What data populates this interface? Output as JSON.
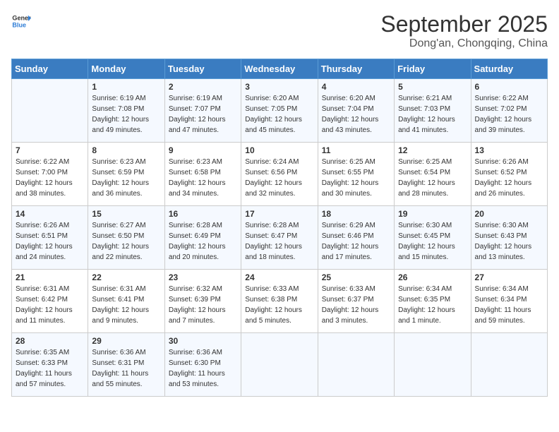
{
  "header": {
    "logo_general": "General",
    "logo_blue": "Blue",
    "month_title": "September 2025",
    "location": "Dong'an, Chongqing, China"
  },
  "days_of_week": [
    "Sunday",
    "Monday",
    "Tuesday",
    "Wednesday",
    "Thursday",
    "Friday",
    "Saturday"
  ],
  "weeks": [
    [
      {
        "day": "",
        "sunrise": "",
        "sunset": "",
        "daylight": ""
      },
      {
        "day": "1",
        "sunrise": "Sunrise: 6:19 AM",
        "sunset": "Sunset: 7:08 PM",
        "daylight": "Daylight: 12 hours and 49 minutes."
      },
      {
        "day": "2",
        "sunrise": "Sunrise: 6:19 AM",
        "sunset": "Sunset: 7:07 PM",
        "daylight": "Daylight: 12 hours and 47 minutes."
      },
      {
        "day": "3",
        "sunrise": "Sunrise: 6:20 AM",
        "sunset": "Sunset: 7:05 PM",
        "daylight": "Daylight: 12 hours and 45 minutes."
      },
      {
        "day": "4",
        "sunrise": "Sunrise: 6:20 AM",
        "sunset": "Sunset: 7:04 PM",
        "daylight": "Daylight: 12 hours and 43 minutes."
      },
      {
        "day": "5",
        "sunrise": "Sunrise: 6:21 AM",
        "sunset": "Sunset: 7:03 PM",
        "daylight": "Daylight: 12 hours and 41 minutes."
      },
      {
        "day": "6",
        "sunrise": "Sunrise: 6:22 AM",
        "sunset": "Sunset: 7:02 PM",
        "daylight": "Daylight: 12 hours and 39 minutes."
      }
    ],
    [
      {
        "day": "7",
        "sunrise": "Sunrise: 6:22 AM",
        "sunset": "Sunset: 7:00 PM",
        "daylight": "Daylight: 12 hours and 38 minutes."
      },
      {
        "day": "8",
        "sunrise": "Sunrise: 6:23 AM",
        "sunset": "Sunset: 6:59 PM",
        "daylight": "Daylight: 12 hours and 36 minutes."
      },
      {
        "day": "9",
        "sunrise": "Sunrise: 6:23 AM",
        "sunset": "Sunset: 6:58 PM",
        "daylight": "Daylight: 12 hours and 34 minutes."
      },
      {
        "day": "10",
        "sunrise": "Sunrise: 6:24 AM",
        "sunset": "Sunset: 6:56 PM",
        "daylight": "Daylight: 12 hours and 32 minutes."
      },
      {
        "day": "11",
        "sunrise": "Sunrise: 6:25 AM",
        "sunset": "Sunset: 6:55 PM",
        "daylight": "Daylight: 12 hours and 30 minutes."
      },
      {
        "day": "12",
        "sunrise": "Sunrise: 6:25 AM",
        "sunset": "Sunset: 6:54 PM",
        "daylight": "Daylight: 12 hours and 28 minutes."
      },
      {
        "day": "13",
        "sunrise": "Sunrise: 6:26 AM",
        "sunset": "Sunset: 6:52 PM",
        "daylight": "Daylight: 12 hours and 26 minutes."
      }
    ],
    [
      {
        "day": "14",
        "sunrise": "Sunrise: 6:26 AM",
        "sunset": "Sunset: 6:51 PM",
        "daylight": "Daylight: 12 hours and 24 minutes."
      },
      {
        "day": "15",
        "sunrise": "Sunrise: 6:27 AM",
        "sunset": "Sunset: 6:50 PM",
        "daylight": "Daylight: 12 hours and 22 minutes."
      },
      {
        "day": "16",
        "sunrise": "Sunrise: 6:28 AM",
        "sunset": "Sunset: 6:49 PM",
        "daylight": "Daylight: 12 hours and 20 minutes."
      },
      {
        "day": "17",
        "sunrise": "Sunrise: 6:28 AM",
        "sunset": "Sunset: 6:47 PM",
        "daylight": "Daylight: 12 hours and 18 minutes."
      },
      {
        "day": "18",
        "sunrise": "Sunrise: 6:29 AM",
        "sunset": "Sunset: 6:46 PM",
        "daylight": "Daylight: 12 hours and 17 minutes."
      },
      {
        "day": "19",
        "sunrise": "Sunrise: 6:30 AM",
        "sunset": "Sunset: 6:45 PM",
        "daylight": "Daylight: 12 hours and 15 minutes."
      },
      {
        "day": "20",
        "sunrise": "Sunrise: 6:30 AM",
        "sunset": "Sunset: 6:43 PM",
        "daylight": "Daylight: 12 hours and 13 minutes."
      }
    ],
    [
      {
        "day": "21",
        "sunrise": "Sunrise: 6:31 AM",
        "sunset": "Sunset: 6:42 PM",
        "daylight": "Daylight: 12 hours and 11 minutes."
      },
      {
        "day": "22",
        "sunrise": "Sunrise: 6:31 AM",
        "sunset": "Sunset: 6:41 PM",
        "daylight": "Daylight: 12 hours and 9 minutes."
      },
      {
        "day": "23",
        "sunrise": "Sunrise: 6:32 AM",
        "sunset": "Sunset: 6:39 PM",
        "daylight": "Daylight: 12 hours and 7 minutes."
      },
      {
        "day": "24",
        "sunrise": "Sunrise: 6:33 AM",
        "sunset": "Sunset: 6:38 PM",
        "daylight": "Daylight: 12 hours and 5 minutes."
      },
      {
        "day": "25",
        "sunrise": "Sunrise: 6:33 AM",
        "sunset": "Sunset: 6:37 PM",
        "daylight": "Daylight: 12 hours and 3 minutes."
      },
      {
        "day": "26",
        "sunrise": "Sunrise: 6:34 AM",
        "sunset": "Sunset: 6:35 PM",
        "daylight": "Daylight: 12 hours and 1 minute."
      },
      {
        "day": "27",
        "sunrise": "Sunrise: 6:34 AM",
        "sunset": "Sunset: 6:34 PM",
        "daylight": "Daylight: 11 hours and 59 minutes."
      }
    ],
    [
      {
        "day": "28",
        "sunrise": "Sunrise: 6:35 AM",
        "sunset": "Sunset: 6:33 PM",
        "daylight": "Daylight: 11 hours and 57 minutes."
      },
      {
        "day": "29",
        "sunrise": "Sunrise: 6:36 AM",
        "sunset": "Sunset: 6:31 PM",
        "daylight": "Daylight: 11 hours and 55 minutes."
      },
      {
        "day": "30",
        "sunrise": "Sunrise: 6:36 AM",
        "sunset": "Sunset: 6:30 PM",
        "daylight": "Daylight: 11 hours and 53 minutes."
      },
      {
        "day": "",
        "sunrise": "",
        "sunset": "",
        "daylight": ""
      },
      {
        "day": "",
        "sunrise": "",
        "sunset": "",
        "daylight": ""
      },
      {
        "day": "",
        "sunrise": "",
        "sunset": "",
        "daylight": ""
      },
      {
        "day": "",
        "sunrise": "",
        "sunset": "",
        "daylight": ""
      }
    ]
  ]
}
